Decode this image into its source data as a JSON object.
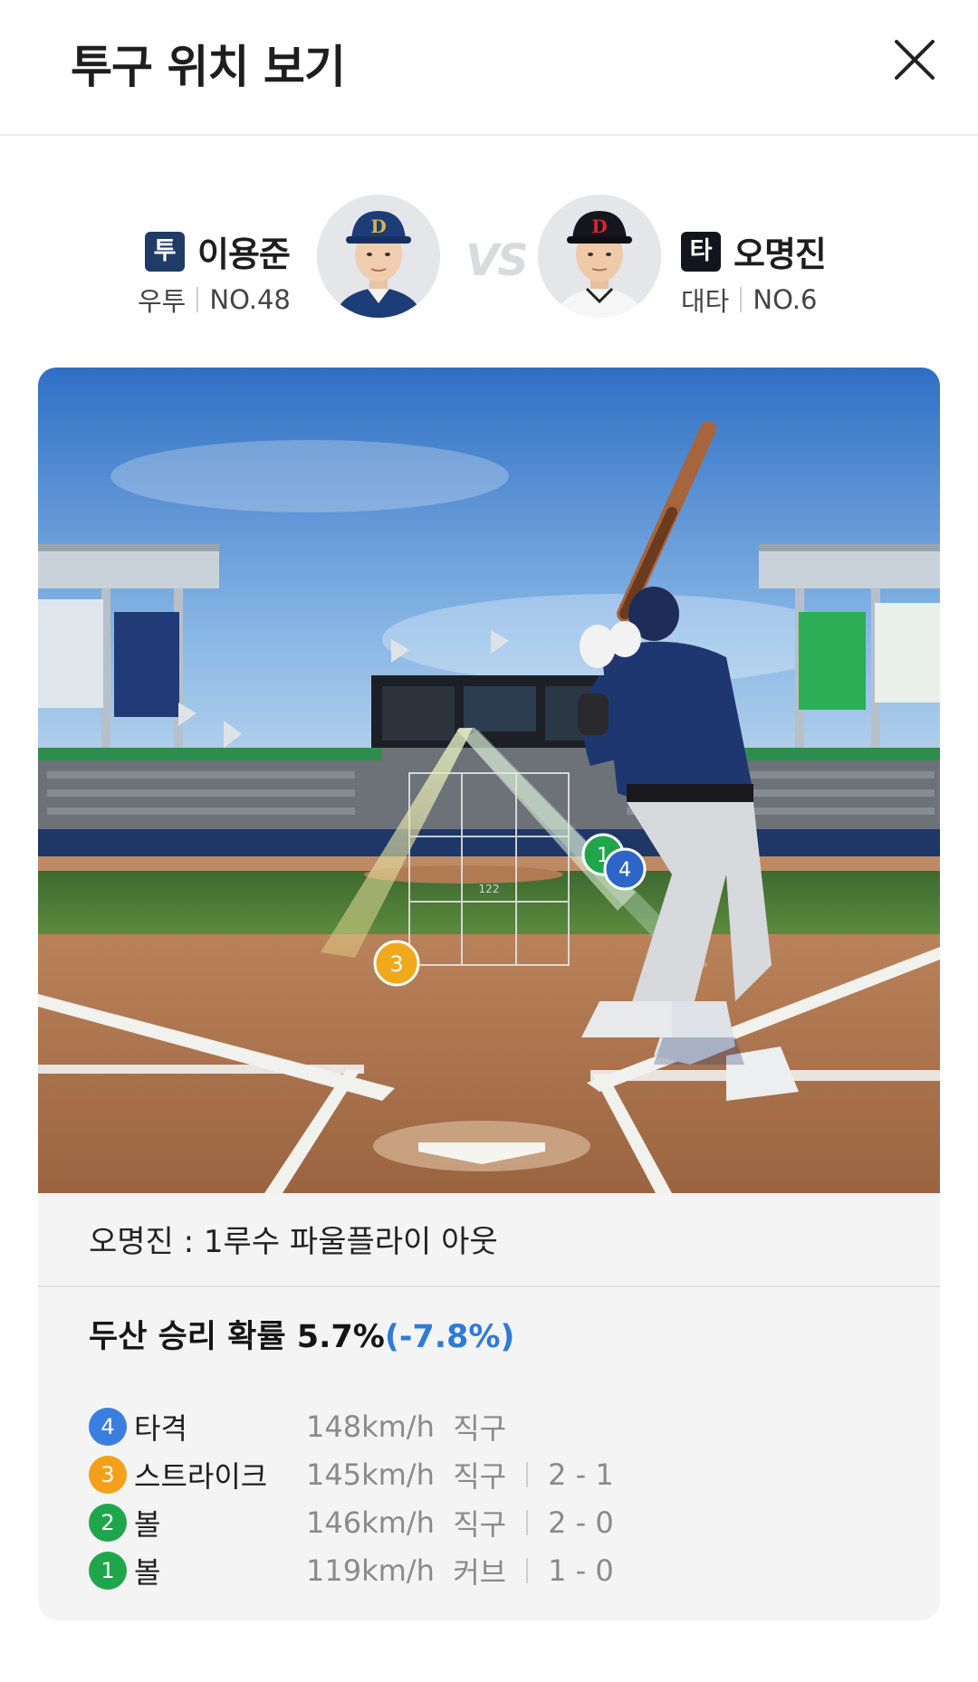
{
  "header": {
    "title": "투구 위치 보기"
  },
  "pitcher": {
    "badge": "투",
    "name": "이용준",
    "throws": "우투",
    "number": "NO.48"
  },
  "vs_label": "VS",
  "batter": {
    "badge": "타",
    "name": "오명진",
    "bats": "대타",
    "number": "NO.6"
  },
  "field": {
    "zone_number": "122",
    "markers": [
      {
        "num": "1",
        "color": "#1fa64a"
      },
      {
        "num": "4",
        "color": "#2d66c8"
      },
      {
        "num": "3",
        "color": "#f0a81c"
      }
    ]
  },
  "result": {
    "text": "오명진 : 1루수 파울플라이 아웃"
  },
  "win_probability": {
    "text": "두산 승리 확률 5.7%",
    "delta": "(-7.8%)"
  },
  "pitches": [
    {
      "num": "4",
      "color": "#3a7ee0",
      "label": "타격",
      "speed": "148km/h",
      "type": "직구",
      "count": ""
    },
    {
      "num": "3",
      "color": "#f5a01a",
      "label": "스트라이크",
      "speed": "145km/h",
      "type": "직구",
      "count": "2 - 1"
    },
    {
      "num": "2",
      "color": "#1fa64a",
      "label": "볼",
      "speed": "146km/h",
      "type": "직구",
      "count": "2 - 0"
    },
    {
      "num": "1",
      "color": "#1fa64a",
      "label": "볼",
      "speed": "119km/h",
      "type": "커브",
      "count": "1 - 0"
    }
  ]
}
